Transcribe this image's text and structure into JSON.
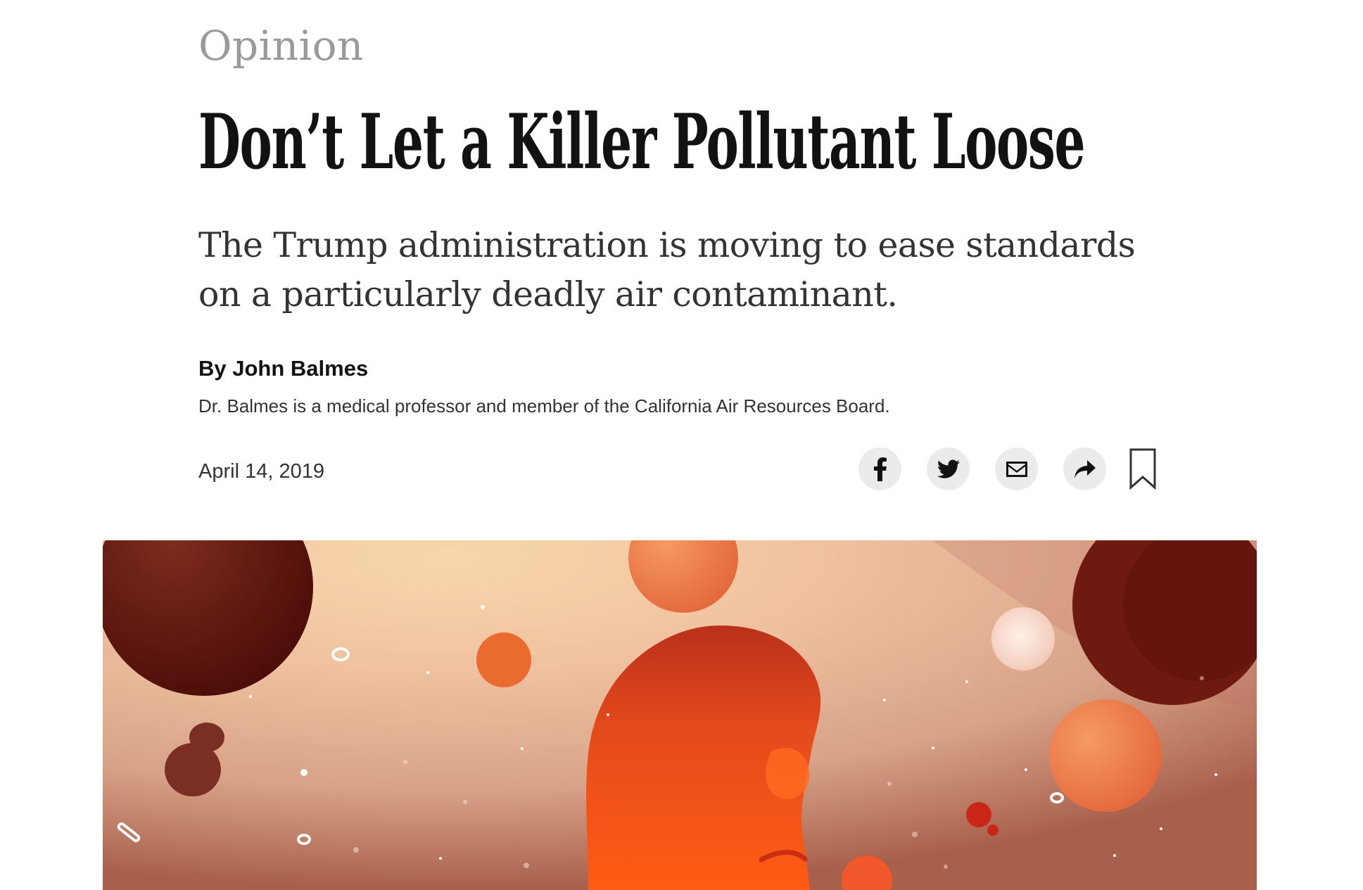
{
  "article": {
    "section": "Opinion",
    "headline": "Don’t Let a Killer Pollutant Loose",
    "summary": "The Trump administration is moving to ease standards on a particularly deadly air contaminant.",
    "byline": "By John Balmes",
    "author_bio": "Dr. Balmes is a medical professor and member of the California Air Resources Board.",
    "date": "April 14, 2019"
  },
  "share": {
    "icons": [
      "facebook-icon",
      "twitter-icon",
      "email-icon",
      "share-arrow-icon",
      "bookmark-icon"
    ]
  },
  "colors": {
    "text_primary": "#121212",
    "text_secondary": "#333333",
    "section_label": "#9a9a9a",
    "share_button_bg": "#ebebeb",
    "hero_warm_light": "#f4cfa8",
    "hero_dark": "#5a130c",
    "hero_orange": "#f05620"
  }
}
